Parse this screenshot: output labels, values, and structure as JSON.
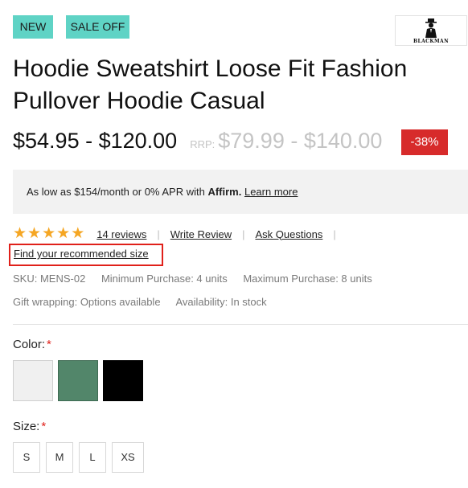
{
  "badges": {
    "new": "NEW",
    "sale": "SALE OFF"
  },
  "brand": {
    "name": "BLACKMAN",
    "icon": "man-in-hat-logo"
  },
  "product": {
    "title": "Hoodie Sweatshirt Loose Fit Fashion Pullover Hoodie Casual",
    "price": "$54.95 - $120.00",
    "rrp_label": "RRP:",
    "rrp": "$79.99 - $140.00",
    "discount": "-38%"
  },
  "affirm": {
    "text_prefix": "As low as $154/month or 0% APR with ",
    "brand": "Affirm.",
    "link": "Learn more"
  },
  "rating": {
    "stars": 5,
    "reviews_link": "14 reviews",
    "write_review": "Write Review",
    "ask_questions": "Ask Questions",
    "find_size": "Find your recommended size"
  },
  "meta": {
    "sku": "SKU: MENS-02",
    "min_purchase": "Minimum Purchase: 4 units",
    "max_purchase": "Maximum Purchase: 8 units",
    "gift": "Gift wrapping: Options available",
    "availability": "Availability: In stock"
  },
  "options": {
    "color_label": "Color:",
    "size_label": "Size:",
    "required_mark": "*",
    "colors": [
      {
        "name": "white",
        "hex": "#f0f0f0"
      },
      {
        "name": "green",
        "hex": "#52866a"
      },
      {
        "name": "black",
        "hex": "#000000"
      }
    ],
    "sizes": [
      "S",
      "M",
      "L",
      "XS"
    ]
  },
  "colors": {
    "accent_badge": "#5fd3c5",
    "discount": "#d72b2b",
    "highlight_border": "#e0201a",
    "star": "#f5a623"
  }
}
